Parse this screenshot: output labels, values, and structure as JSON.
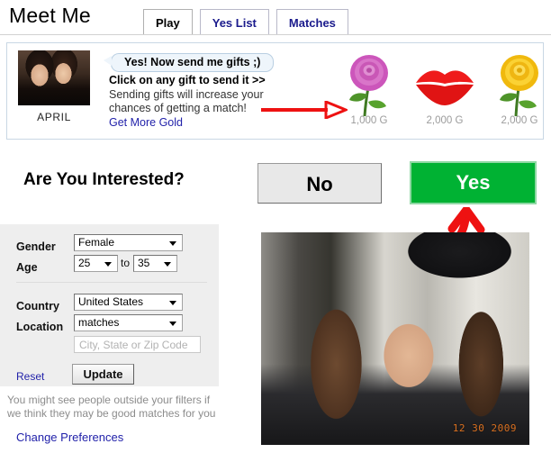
{
  "header": {
    "title": "Meet Me",
    "tabs": [
      {
        "label": "Play",
        "active": true
      },
      {
        "label": "Yes List",
        "active": false
      },
      {
        "label": "Matches",
        "active": false
      }
    ]
  },
  "gift_banner": {
    "profile_name": "APRIL",
    "speech_bubble": "Yes! Now send me gifts ;)",
    "instructions_bold": "Click on any gift to send it >>",
    "instructions_rest": " Sending gifts will increase your chances of getting a match!",
    "get_more_gold_label": "Get More Gold",
    "gifts": [
      {
        "name": "pink-rose",
        "price": "1,000 G"
      },
      {
        "name": "red-lips",
        "price": "2,000 G"
      },
      {
        "name": "yellow-rose",
        "price": "2,000 G"
      }
    ]
  },
  "interest": {
    "question": "Are You Interested?",
    "no_label": "No",
    "yes_label": "Yes"
  },
  "filters": {
    "gender_label": "Gender",
    "gender_value": "Female",
    "age_label": "Age",
    "age_min": "25",
    "age_to": "to",
    "age_max": "35",
    "country_label": "Country",
    "country_value": "United States",
    "location_label": "Location",
    "location_value": "matches",
    "zip_placeholder": "City, State or Zip Code",
    "zip_value": "",
    "reset_label": "Reset",
    "update_label": "Update",
    "note": "You might see people outside your filters if we think they may be good matches for you",
    "change_preferences_label": "Change Preferences"
  },
  "photo": {
    "date_stamp": "12 30 2009"
  },
  "colors": {
    "yes_green": "#00b233",
    "link_blue": "#2222aa",
    "arrow_red": "#ee1111",
    "panel_gray": "#eeeeee",
    "price_gray": "#9b9b9b"
  }
}
